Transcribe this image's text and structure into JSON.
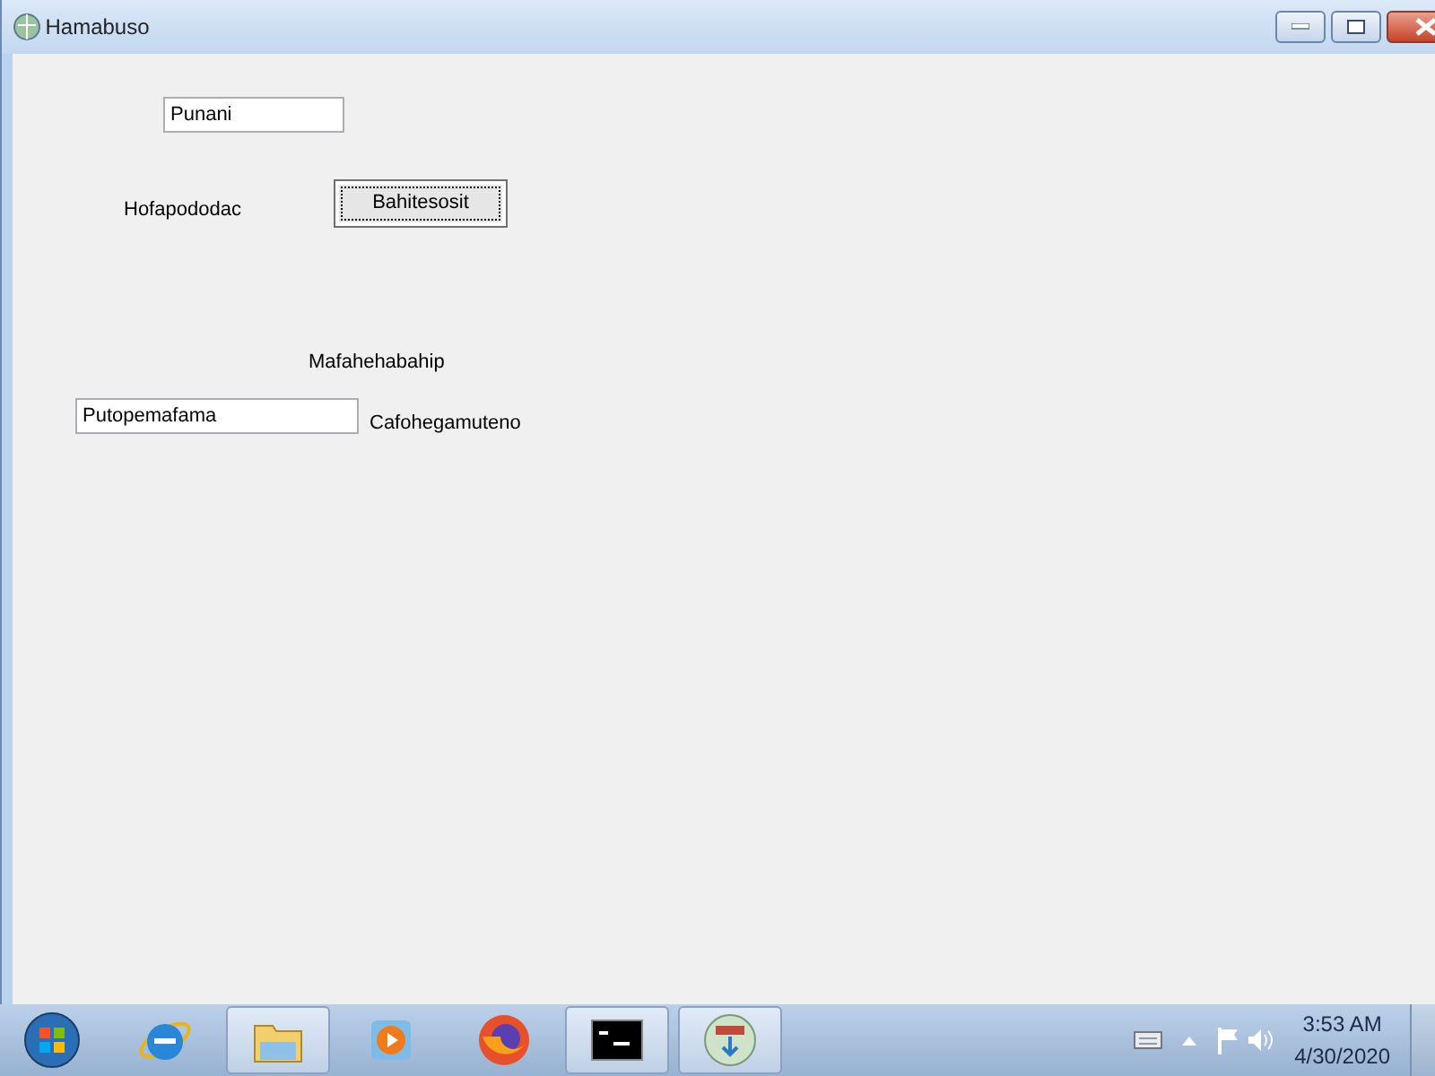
{
  "window": {
    "title": "Hamabuso"
  },
  "controls": [
    {
      "kind": "textbox",
      "value": "Punani"
    },
    {
      "kind": "label",
      "text": "Hofapododac"
    },
    {
      "kind": "button",
      "text": "Bahitesosit"
    },
    {
      "kind": "label",
      "text": "Mafahehabahip"
    },
    {
      "kind": "textbox",
      "value": "Putopemafama"
    },
    {
      "kind": "label",
      "text": "Cafohegamuteno"
    }
  ],
  "taskbar": {
    "apps": [
      {
        "running": false
      },
      {
        "running": false
      },
      {
        "running": true
      },
      {
        "running": false
      },
      {
        "running": false
      },
      {
        "running": true
      },
      {
        "running": true
      }
    ],
    "time": "3:53 AM",
    "date": "4/30/2020"
  }
}
